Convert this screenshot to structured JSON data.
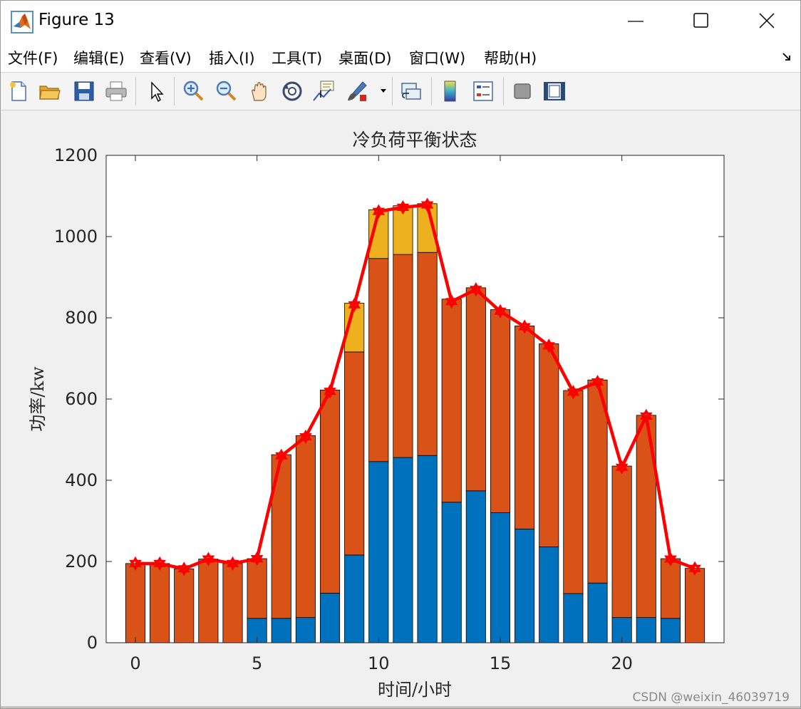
{
  "window": {
    "title": "Figure 13"
  },
  "menu": {
    "items": [
      "文件(F)",
      "编辑(E)",
      "查看(V)",
      "插入(I)",
      "工具(T)",
      "桌面(D)",
      "窗口(W)",
      "帮助(H)"
    ]
  },
  "toolbar": {
    "icons": [
      "new-figure-icon",
      "open-file-icon",
      "save-icon",
      "print-icon",
      "pointer-icon",
      "zoom-in-icon",
      "zoom-out-icon",
      "pan-icon",
      "rotate-3d-icon",
      "data-cursor-icon",
      "brush-icon",
      "link-plot-icon",
      "colorbar-icon",
      "legend-icon",
      "hide-plot-tools-icon",
      "show-plot-tools-icon"
    ]
  },
  "watermark": "CSDN @weixin_46039719",
  "colors": {
    "series_blue": "#0072BD",
    "series_orange": "#D95319",
    "series_yellow": "#EDB120",
    "line_red": "#FF0000"
  },
  "chart_data": {
    "type": "bar",
    "stacked": true,
    "title": "冷负荷平衡状态",
    "xlabel": "时间/小时",
    "ylabel": "功率/kw",
    "xlim": [
      -1.2,
      24.2
    ],
    "ylim": [
      0,
      1200
    ],
    "xticks": [
      0,
      5,
      10,
      15,
      20
    ],
    "yticks": [
      0,
      200,
      400,
      600,
      800,
      1000,
      1200
    ],
    "x": [
      0,
      1,
      2,
      3,
      4,
      5,
      6,
      7,
      8,
      9,
      10,
      11,
      12,
      13,
      14,
      15,
      16,
      17,
      18,
      19,
      20,
      21,
      22,
      23
    ],
    "series": [
      {
        "color": "#0072BD",
        "values": [
          0,
          0,
          0,
          0,
          0,
          60,
          60,
          62,
          122,
          216,
          446,
          456,
          461,
          346,
          374,
          320,
          280,
          236,
          121,
          147,
          62,
          62,
          60,
          0
        ]
      },
      {
        "color": "#D95319",
        "values": [
          195,
          195,
          182,
          206,
          195,
          147,
          403,
          448,
          500,
          500,
          500,
          500,
          500,
          500,
          500,
          500,
          500,
          500,
          500,
          500,
          373,
          498,
          147,
          183
        ]
      },
      {
        "color": "#EDB120",
        "values": [
          0,
          0,
          0,
          0,
          0,
          0,
          0,
          0,
          0,
          120,
          120,
          120,
          120,
          0,
          0,
          0,
          0,
          0,
          0,
          0,
          0,
          0,
          0,
          0
        ]
      }
    ],
    "line": {
      "color": "#FF0000",
      "marker": "hexagram",
      "values": [
        195,
        195,
        182,
        206,
        195,
        207,
        460,
        507,
        619,
        832,
        1062,
        1072,
        1078,
        840,
        870,
        816,
        778,
        731,
        617,
        642,
        432,
        558,
        206,
        183
      ]
    },
    "grid": false,
    "legend": "none"
  }
}
